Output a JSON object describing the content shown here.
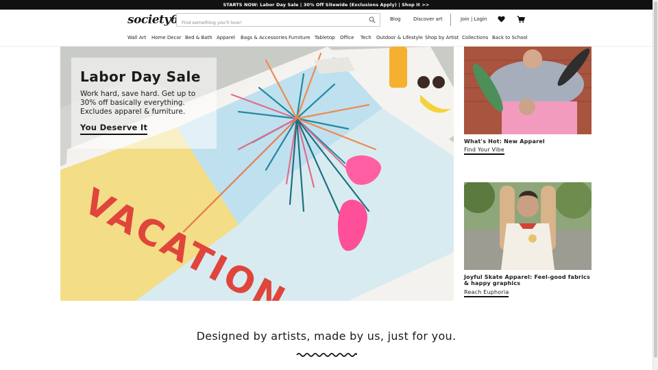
{
  "promo": {
    "text": "STARTS NOW: Labor Day Sale | 30% Off Sitewide (Exclusions Apply) | Shop It >>"
  },
  "header": {
    "logo": "society6",
    "search_placeholder": "Find something you'll love!",
    "blog": "Blog",
    "discover": "Discover art",
    "join": "Join | Login",
    "icons": {
      "search": "search-icon",
      "wishlist": "heart-icon",
      "cart": "cart-icon"
    }
  },
  "categories": [
    "Wall Art",
    "Home Decor",
    "Bed & Bath",
    "Apparel",
    "Bags & Accessories",
    "Furniture",
    "Tabletop",
    "Office",
    "Tech",
    "Outdoor & Lifestyle",
    "Shop by Artist",
    "Collections",
    "Back to School"
  ],
  "hero": {
    "title": "Labor Day Sale",
    "body": "Work hard, save hard. Get up to 30% off basically everything. Excludes apparel & furniture.",
    "cta": "You Deserve It",
    "towel_text": "VACATION"
  },
  "side_promos": [
    {
      "title": "What's Hot: New Apparel",
      "link": "Find Your Vibe"
    },
    {
      "title": "Joyful Skate Apparel: Feel-good fabrics & happy graphics",
      "link": "Reach Euphoria"
    }
  ],
  "tagline": "Designed by artists, made by us, just for you.",
  "colors": {
    "promo_bg": "#111111",
    "accent_pink": "#ff5fa2",
    "text": "#1a1a1a"
  }
}
